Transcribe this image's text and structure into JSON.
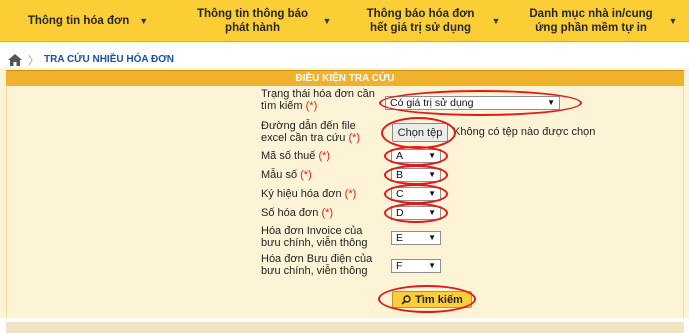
{
  "nav": {
    "items": [
      {
        "label": "Thông tin hóa đơn"
      },
      {
        "label": "Thông tin thông báo phát hành"
      },
      {
        "label": "Thông báo hóa đơn hết giá trị sử dụng"
      },
      {
        "label": "Danh mục nhà in/cung ứng phần mềm tự in"
      }
    ]
  },
  "breadcrumb": {
    "current": "TRA CỨU NHIỀU HÓA ĐƠN"
  },
  "panel": {
    "title": "ĐIỀU KIỆN TRA CỨU"
  },
  "form": {
    "status": {
      "label": "Trạng thái hóa đơn cần tìm kiếm",
      "required": "(*)",
      "value": "Có giá trị sử dụng"
    },
    "excel": {
      "label": "Đường dẫn đến file excel cần tra cứu",
      "required": "(*)",
      "button": "Chọn tệp",
      "no_file": "Không có tệp nào được chọn"
    },
    "tax_code": {
      "label": "Mã số thuế",
      "required": "(*)",
      "value": "A"
    },
    "template": {
      "label": "Mẫu số",
      "required": "(*)",
      "value": "B"
    },
    "symbol": {
      "label": "Ký hiệu hóa đơn",
      "required": "(*)",
      "value": "C"
    },
    "number": {
      "label": "Số hóa đơn",
      "required": "(*)",
      "value": "D"
    },
    "postal_invoice": {
      "label": "Hóa đơn Invoice của bưu chính, viễn thông",
      "value": "E"
    },
    "postal_bill": {
      "label": "Hóa đơn Bưu điện của bưu chính, viễn thông",
      "value": "F"
    },
    "search_button": "Tìm kiếm"
  },
  "colors": {
    "nav_bg": "#fbce36",
    "panel_head": "#f0b12d",
    "annotation": "#e01a1a",
    "required": "#e0201c"
  }
}
